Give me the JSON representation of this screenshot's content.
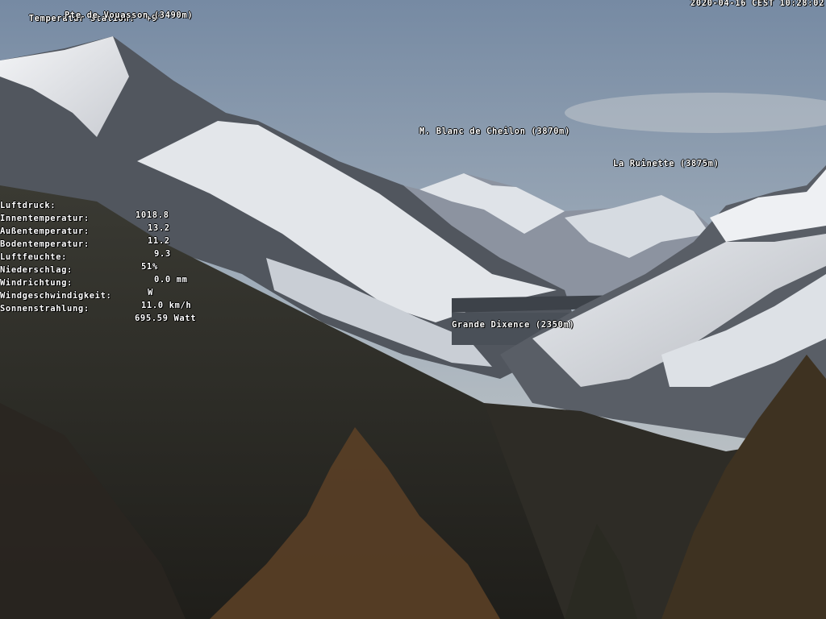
{
  "overlay": {
    "station_label": "Temperatur Station:",
    "station_value": "+9°",
    "timestamp": "2020-04-16 CEST 10:28:02"
  },
  "peaks": [
    {
      "id": "vouasson",
      "label": "Pte de Vouasson (3490m)"
    },
    {
      "id": "cheilon",
      "label": "M. Blanc de Cheilon (3870m)"
    },
    {
      "id": "ruinette",
      "label": "La Ruinette (3875m)"
    },
    {
      "id": "dixence",
      "label": "Grande Dixence (2350m)"
    }
  ],
  "weather": [
    {
      "label": "Luftdruck:",
      "value": "1018.8"
    },
    {
      "label": "Innentemperatur:",
      "value": "13.2"
    },
    {
      "label": "Außentemperatur:",
      "value": "11.2"
    },
    {
      "label": "Bodentemperatur:",
      "value": "9.3"
    },
    {
      "label": "Luftfeuchte:",
      "value": "51%"
    },
    {
      "label": "Niederschlag:",
      "value": "0.0 mm"
    },
    {
      "label": "Windrichtung:",
      "value": "W"
    },
    {
      "label": "Windgeschwindigkeit:",
      "value": "11.0 km/h"
    },
    {
      "label": "Sonnenstrahlung:",
      "value": "695.59 Watt"
    }
  ],
  "colors": {
    "sky_top": "#7d8fa6",
    "sky_bottom": "#c7c9c8",
    "snow": "#eef0f2",
    "rock": "#4a4e55",
    "forest": "#2b2a24",
    "larch": "#5a3f26"
  }
}
